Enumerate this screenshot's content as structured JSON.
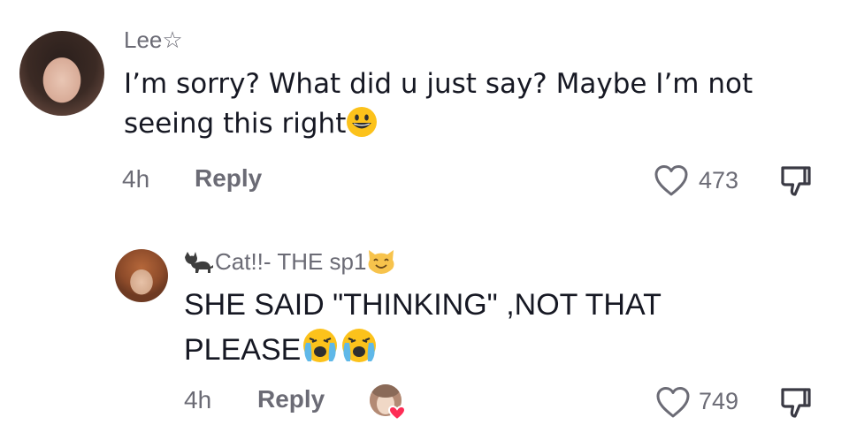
{
  "comments": [
    {
      "username": "Lee☆",
      "text": "I’m sorry? What did u just say? Maybe I’m not seeing this right",
      "text_line1": "I’m sorry? What did u just say? Maybe I’m not",
      "text_line2": "seeing this right",
      "emoji": "grinning-face",
      "time": "4h",
      "reply_label": "Reply",
      "likes": "473"
    },
    {
      "username_prefix_icon": "black-cat-emoji",
      "username": "Cat!!- THE sp1",
      "username_suffix_icon": "smiling-cat-emoji",
      "text_line1": "SHE SAID \"THINKING\" ,NOT THAT",
      "text_line2": "PLEASE",
      "emojis": [
        "loudly-crying-face",
        "loudly-crying-face"
      ],
      "time": "4h",
      "reply_label": "Reply",
      "likes": "749",
      "creator_liked": true
    }
  ]
}
